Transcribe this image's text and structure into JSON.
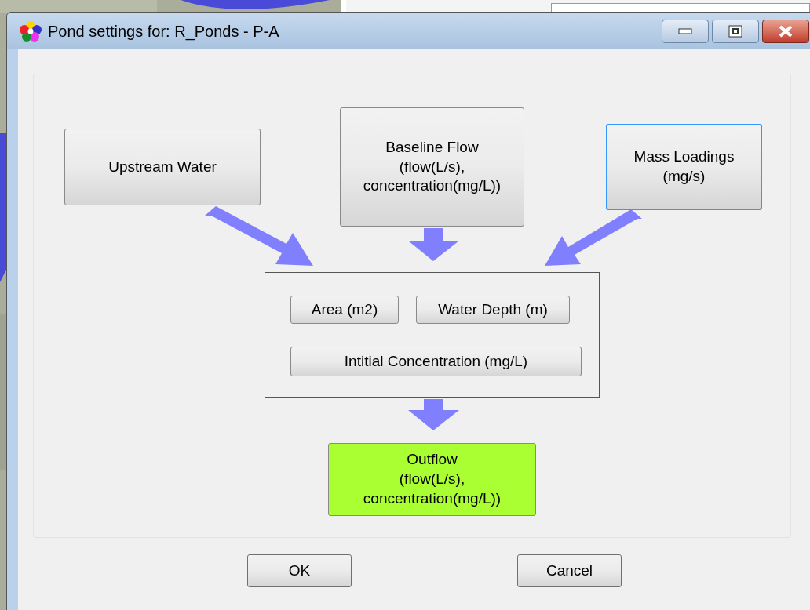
{
  "window": {
    "title": "Pond settings for: R_Ponds - P-A"
  },
  "inputs": [
    {
      "label": "Upstream Water",
      "focused": false
    },
    {
      "label": "Baseline Flow\n(flow(L/s),\nconcentration(mg/L))",
      "focused": false
    },
    {
      "label": "Mass Loadings\n(mg/s)",
      "focused": true
    }
  ],
  "pond": {
    "fields": [
      {
        "label": "Area (m2)"
      },
      {
        "label": "Water Depth (m)"
      },
      {
        "label": "Intitial Concentration (mg/L)"
      }
    ]
  },
  "outflow": {
    "label": "Outflow\n(flow(L/s),\nconcentration(mg/L))",
    "color": "#aaff33"
  },
  "buttons": [
    "OK",
    "Cancel"
  ]
}
